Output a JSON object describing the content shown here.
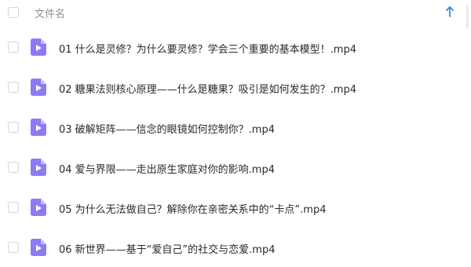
{
  "header": {
    "name_column": "文件名",
    "sort_icon": "arrow-up-icon"
  },
  "files": [
    {
      "name": "01 什么是灵修？为什么要灵修？学会三个重要的基本模型！.mp4",
      "icon": "video-file-icon"
    },
    {
      "name": "02 糖果法则核心原理——什么是糖果？吸引是如何发生的？.mp4",
      "icon": "video-file-icon"
    },
    {
      "name": "03 破解矩阵——信念的眼镜如何控制你？.mp4",
      "icon": "video-file-icon"
    },
    {
      "name": "04 爱与界限——走出原生家庭对你的影响.mp4",
      "icon": "video-file-icon"
    },
    {
      "name": "05 为什么无法做自己？解除你在亲密关系中的“卡点”.mp4",
      "icon": "video-file-icon"
    },
    {
      "name": "06 新世界——基于“爱自己”的社交与恋爱.mp4",
      "icon": "video-file-icon"
    }
  ],
  "colors": {
    "icon_bg": "#8b7cf6",
    "icon_fold": "#c7bffc",
    "sort_arrow": "#2f86f6",
    "text": "#27292e",
    "header_text": "#8a8f99"
  }
}
